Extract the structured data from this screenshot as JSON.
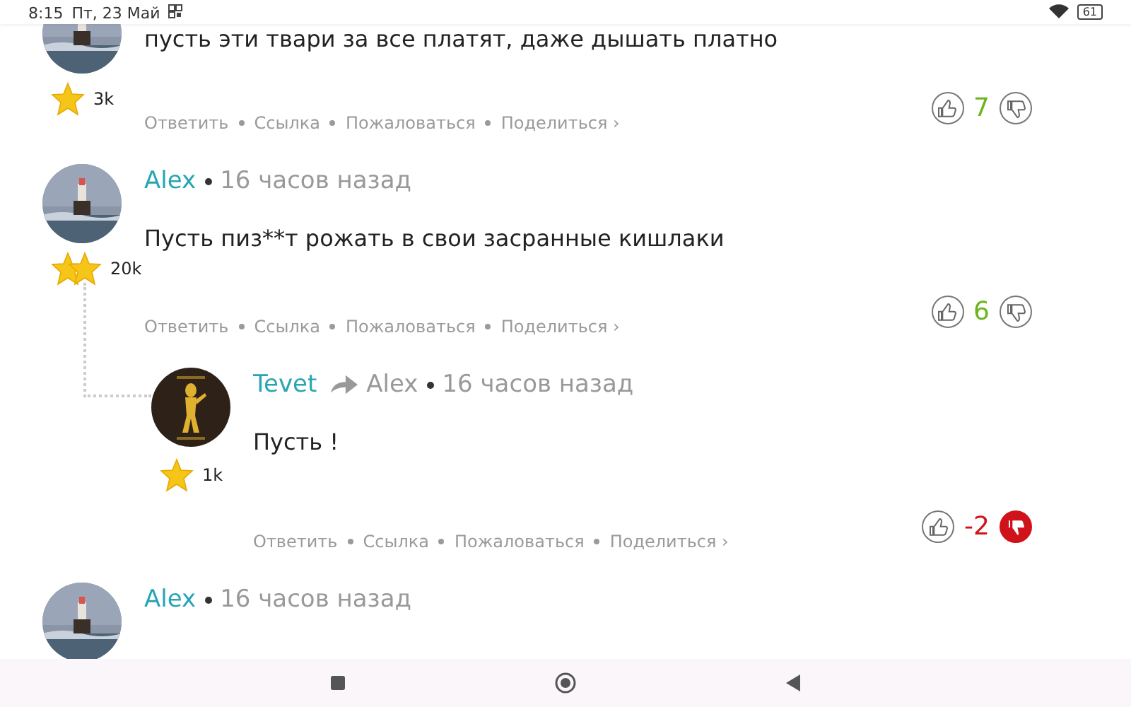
{
  "status_bar": {
    "time": "8:15",
    "date": "Пт, 23 Май",
    "battery": "61"
  },
  "comments": [
    {
      "kind": "cut",
      "text": "пусть эти твари за все платят, даже дышать платно",
      "badge": {
        "kind": "one_star"
      },
      "rating": "3k",
      "actions": [
        "Ответить",
        "Ссылка",
        "Пожаловаться",
        "Поделиться ›"
      ],
      "score": "7",
      "liked": false,
      "disliked": false
    },
    {
      "kind": "full",
      "author": "Alex",
      "time": "16 часов назад",
      "text": "Пусть пиз**т рожать в свои засранные кишлаки",
      "badge": {
        "kind": "two_stars"
      },
      "rating": "20k",
      "actions": [
        "Ответить",
        "Ссылка",
        "Пожаловаться",
        "Поделиться ›"
      ],
      "score": "6",
      "liked": false,
      "disliked": false,
      "replies": [
        {
          "kind": "full",
          "author": "Tevet",
          "reply_to": "Alex",
          "time": "16 часов назад",
          "text": "Пусть !",
          "badge": {
            "kind": "one_star"
          },
          "rating": "1k",
          "actions": [
            "Ответить",
            "Ссылка",
            "Пожаловаться",
            "Поделиться ›"
          ],
          "score": "-2",
          "liked": false,
          "disliked": true
        }
      ]
    },
    {
      "kind": "header",
      "author": "Alex",
      "time": "16 часов назад"
    }
  ]
}
